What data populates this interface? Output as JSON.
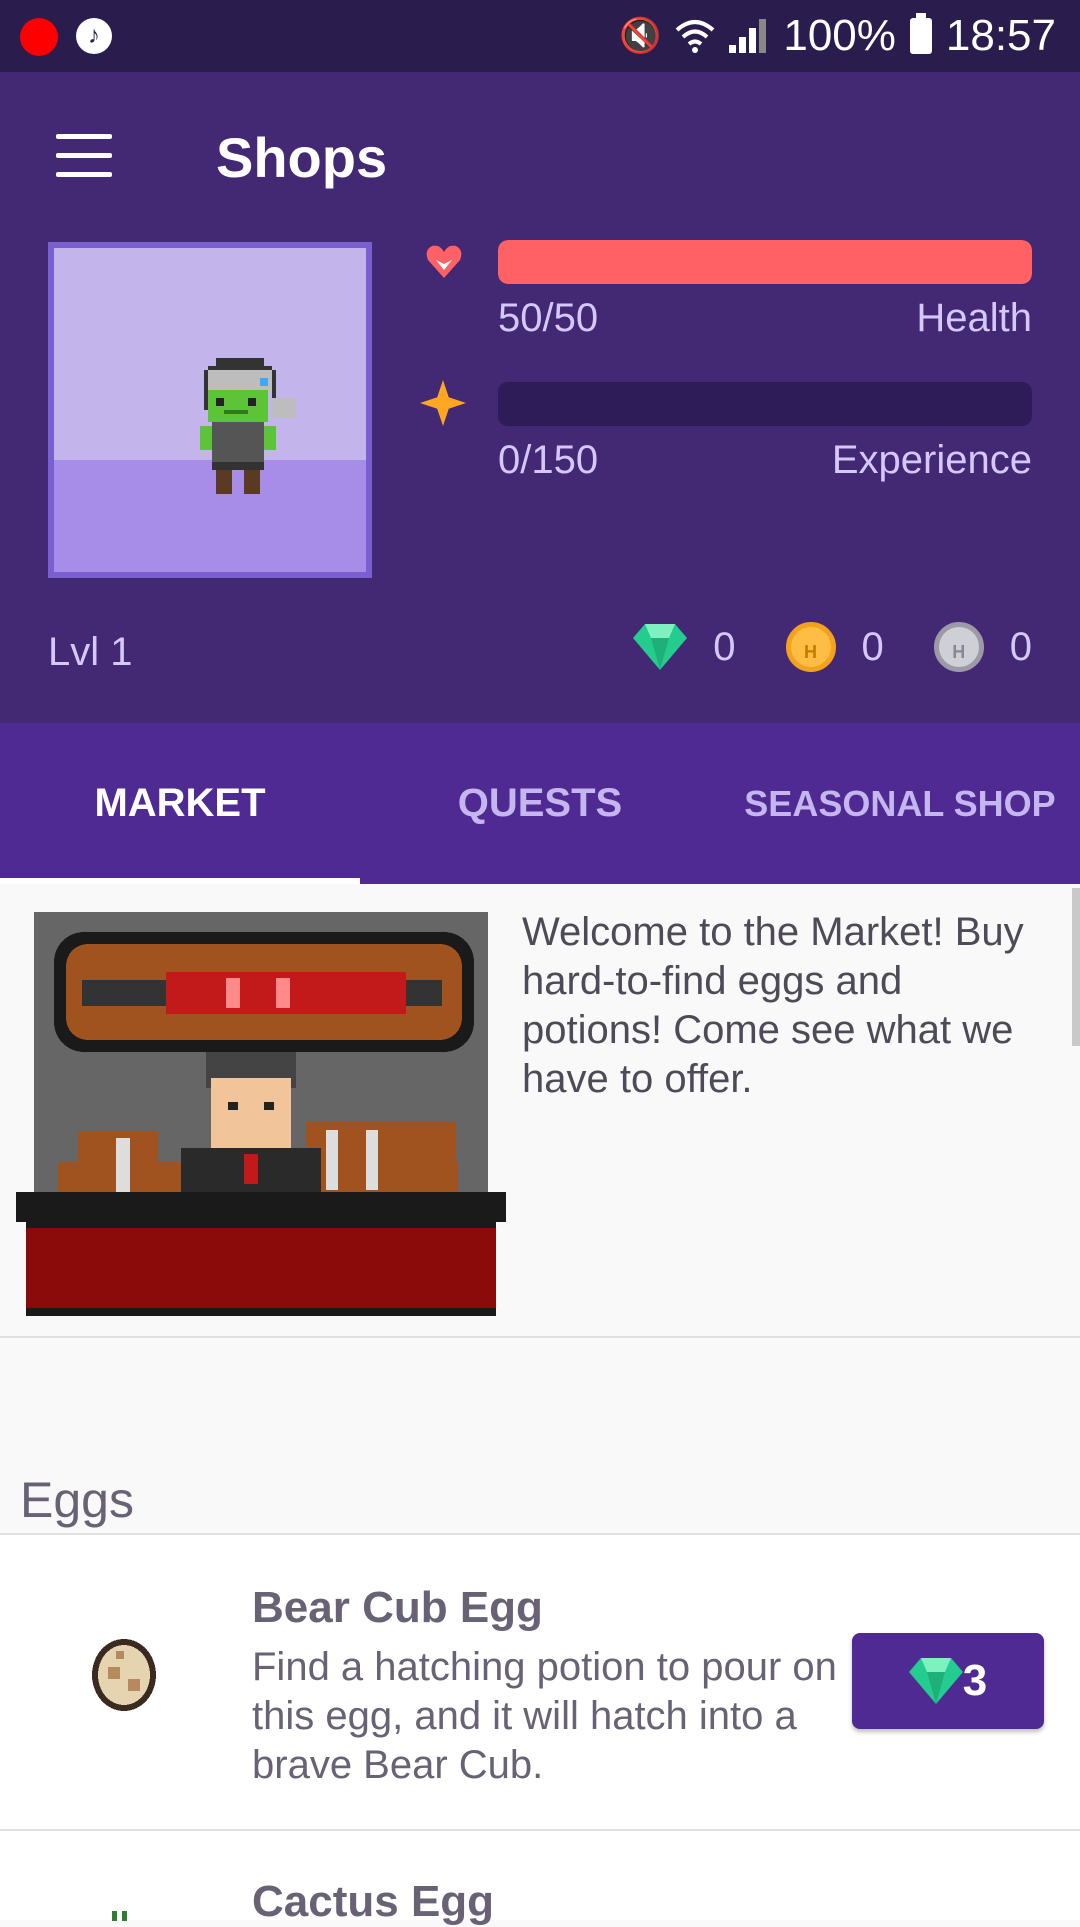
{
  "status_bar": {
    "battery": "100%",
    "time": "18:57",
    "icons": [
      "record-icon",
      "music-icon",
      "mute-icon",
      "wifi-icon",
      "signal-icon",
      "battery-icon"
    ]
  },
  "header": {
    "title": "Shops",
    "menu_icon": "hamburger-menu-icon",
    "health": {
      "value": "50/50",
      "label": "Health",
      "fraction": 1.0,
      "color": "#ff6165",
      "icon": "heart-icon"
    },
    "experience": {
      "value": "0/150",
      "label": "Experience",
      "fraction": 0.0,
      "icon": "star-icon"
    },
    "level": "Lvl 1",
    "gems": "0",
    "gold": "0",
    "hourglasses": "0",
    "coin_letter": "H"
  },
  "tabs": [
    {
      "label": "MARKET",
      "active": true
    },
    {
      "label": "QUESTS",
      "active": false
    },
    {
      "label": "SEASONAL SHOP",
      "active": false
    }
  ],
  "banner": {
    "text": "Welcome to the Market! Buy hard-to-find eggs and potions! Come see what we have to offer."
  },
  "section": {
    "title": "Eggs"
  },
  "items": [
    {
      "name": "Bear Cub Egg",
      "description": "Find a hatching potion to pour on this egg, and it will hatch into a brave Bear Cub.",
      "price": "3",
      "currency_icon": "gem-icon"
    },
    {
      "name": "Cactus Egg"
    }
  ],
  "colors": {
    "primary": "#432874",
    "tabs": "#4f2a93",
    "health": "#ff6165",
    "gem": "#24cc8f",
    "gold": "#ffbe43"
  }
}
